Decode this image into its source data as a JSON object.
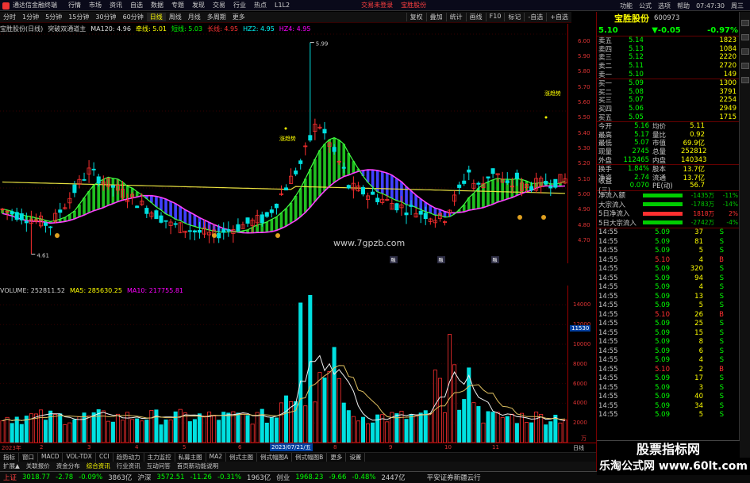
{
  "title": "通达信金融终端",
  "menu": [
    "行情",
    "市场",
    "资讯",
    "自选",
    "数据",
    "专题",
    "发现",
    "交易",
    "行业",
    "热点",
    "L1L2"
  ],
  "notice_left": "交易未登录",
  "notice_right": "宝胜股份",
  "titlebar_right": [
    "功能",
    "公式",
    "选项",
    "帮助"
  ],
  "time": "07:47:30",
  "weekday": "周三",
  "periods": [
    "分时",
    "1分钟",
    "5分钟",
    "15分钟",
    "30分钟",
    "60分钟",
    "日线",
    "周线",
    "月线",
    "多周期",
    "更多"
  ],
  "active_period": "日线",
  "toolbar_right": [
    "复权",
    "叠加",
    "统计",
    "画线",
    "F10",
    "标记",
    "-自选",
    "+自选"
  ],
  "chart_info": {
    "name": "宝胜股份(日线)",
    "indicator": "突破双通道主",
    "ma120": "MA120: 4.96",
    "green_label": "牵线: 5.01",
    "green_val": "短线: 5.03",
    "red_label": "长线: 4.95",
    "hz2": "HZ2: 4.95",
    "hz4": "HZ4: 4.95"
  },
  "price_annotations": {
    "high": "5.99",
    "low": "4.61",
    "buy1": "涨趋势",
    "buy2": "涨趋势",
    "watermark": "www.7gpzb.com",
    "events": [
      "融",
      "融",
      "融"
    ]
  },
  "price_ticks": [
    "6.00",
    "5.90",
    "5.80",
    "5.70",
    "5.60",
    "5.50",
    "5.40",
    "5.30",
    "5.20",
    "5.10",
    "5.00",
    "4.90",
    "4.80",
    "4.70"
  ],
  "volume_info": {
    "label": "VOLUME: 252811.52",
    "ma5": "MA5: 285630.25",
    "ma10": "MA10: 217755.81"
  },
  "vol_ticks": [
    "14000",
    "12000",
    "10000",
    "8000",
    "6000",
    "4000",
    "2000"
  ],
  "vol_highlight": "11530",
  "vol_unit": "万",
  "date_labels": [
    "2023年",
    "2",
    "3",
    "4",
    "5",
    "6",
    "7",
    "8",
    "9",
    "10",
    "11"
  ],
  "date_cursor": "2023/07/21/五",
  "date_corner": "日线",
  "tabs1": [
    "指标",
    "窗口",
    "MACD",
    "VOL-TDX",
    "CCI",
    "趋势动力",
    "主力监控",
    "私募主图",
    "MA2",
    "例式主图",
    "例式幅图A",
    "例式幅图B",
    "更多",
    "设置"
  ],
  "tabs2": [
    "扩展▲",
    "关联报价",
    "资金分布",
    "综合资讯",
    "行业资讯",
    "互动问答",
    "首页新功能说明"
  ],
  "status": {
    "sh_name": "上证",
    "sh_val": "3018.77",
    "sh_chg": "-2.78",
    "sh_pct": "-0.09%",
    "sh_amt": "3863亿",
    "sz_name": "沪深",
    "sz_val": "3572.51",
    "sz_chg": "-11.26",
    "sz_pct": "-0.31%",
    "sz_amt": "1963亿",
    "cy_name": "创业",
    "cy_val": "1968.23",
    "cy_chg": "-9.66",
    "cy_pct": "-0.48%",
    "cy_amt": "2447亿",
    "broker": "平安证券新疆云行"
  },
  "quote": {
    "name": "宝胜股份",
    "code": "600973",
    "price": "5.10",
    "change": "▼-0.05",
    "pct": "-0.97%",
    "sells": [
      {
        "label": "卖五",
        "price": "5.14",
        "vol": "1823"
      },
      {
        "label": "卖四",
        "price": "5.13",
        "vol": "1084"
      },
      {
        "label": "卖三",
        "price": "5.12",
        "vol": "2220"
      },
      {
        "label": "卖二",
        "price": "5.11",
        "vol": "2720"
      },
      {
        "label": "卖一",
        "price": "5.10",
        "vol": "149"
      }
    ],
    "buys": [
      {
        "label": "买一",
        "price": "5.09",
        "vol": "1300"
      },
      {
        "label": "买二",
        "price": "5.08",
        "vol": "3791"
      },
      {
        "label": "买三",
        "price": "5.07",
        "vol": "2254"
      },
      {
        "label": "买四",
        "price": "5.06",
        "vol": "2949"
      },
      {
        "label": "买五",
        "price": "5.05",
        "vol": "1715"
      }
    ],
    "stats1": [
      {
        "a": "今开",
        "b": "5.16",
        "c": "均价",
        "d": "5.11"
      },
      {
        "a": "最高",
        "b": "5.17",
        "c": "量比",
        "d": "0.92"
      },
      {
        "a": "最低",
        "b": "5.07",
        "c": "市值",
        "d": "69.9亿"
      },
      {
        "a": "现量",
        "b": "2745",
        "c": "总量",
        "d": "252812"
      },
      {
        "a": "外盘",
        "b": "112465",
        "c": "内盘",
        "d": "140343"
      }
    ],
    "stats2": [
      {
        "a": "换手",
        "b": "1.84%",
        "c": "股本",
        "d": "13.7亿"
      },
      {
        "a": "净资",
        "b": "2.74",
        "c": "流通",
        "d": "13.7亿"
      },
      {
        "a": "收益(三)",
        "b": "0.070",
        "c": "PE(动)",
        "d": "56.7"
      }
    ],
    "flows": [
      {
        "label": "净流入额",
        "value": "-1435万",
        "pct": "-11%",
        "color": "#00cc00"
      },
      {
        "label": "大宗流入",
        "value": "-1783万",
        "pct": "-14%",
        "color": "#00cc00"
      },
      {
        "label": "5日净流入",
        "value": "1818万",
        "pct": "2%",
        "color": "#ff3030"
      },
      {
        "label": "5日大宗流入",
        "value": "-2742万",
        "pct": "-4%",
        "color": "#00cc00"
      }
    ],
    "ticks": [
      {
        "t": "14:55",
        "p": "5.09",
        "v": "37",
        "bs": "S"
      },
      {
        "t": "14:55",
        "p": "5.09",
        "v": "81",
        "bs": "S"
      },
      {
        "t": "14:55",
        "p": "5.09",
        "v": "5",
        "bs": "S"
      },
      {
        "t": "14:55",
        "p": "5.10",
        "v": "4",
        "bs": "B"
      },
      {
        "t": "14:55",
        "p": "5.09",
        "v": "320",
        "bs": "S"
      },
      {
        "t": "14:55",
        "p": "5.09",
        "v": "94",
        "bs": "S"
      },
      {
        "t": "14:55",
        "p": "5.09",
        "v": "4",
        "bs": "S"
      },
      {
        "t": "14:55",
        "p": "5.09",
        "v": "13",
        "bs": "S"
      },
      {
        "t": "14:55",
        "p": "5.09",
        "v": "5",
        "bs": "S"
      },
      {
        "t": "14:55",
        "p": "5.10",
        "v": "26",
        "bs": "B"
      },
      {
        "t": "14:55",
        "p": "5.09",
        "v": "25",
        "bs": "S"
      },
      {
        "t": "14:55",
        "p": "5.09",
        "v": "15",
        "bs": "S"
      },
      {
        "t": "14:55",
        "p": "5.09",
        "v": "8",
        "bs": "S"
      },
      {
        "t": "14:55",
        "p": "5.09",
        "v": "6",
        "bs": "S"
      },
      {
        "t": "14:55",
        "p": "5.09",
        "v": "4",
        "bs": "S"
      },
      {
        "t": "14:55",
        "p": "5.10",
        "v": "2",
        "bs": "B"
      },
      {
        "t": "14:55",
        "p": "5.09",
        "v": "17",
        "bs": "S"
      },
      {
        "t": "14:55",
        "p": "5.09",
        "v": "3",
        "bs": "S"
      },
      {
        "t": "14:55",
        "p": "5.09",
        "v": "40",
        "bs": "S"
      },
      {
        "t": "14:55",
        "p": "5.09",
        "v": "34",
        "bs": "S"
      },
      {
        "t": "14:55",
        "p": "5.09",
        "v": "5",
        "bs": "S"
      }
    ]
  },
  "watermark1": "股票指标网",
  "watermark2": "乐淘公式网 www.60lt.com",
  "colors": {
    "up": "#ff3030",
    "down": "#00e0e0",
    "ma_yellow": "#e8e040",
    "ma_pink": "#ff40ff",
    "ma_green": "#40ff40"
  }
}
